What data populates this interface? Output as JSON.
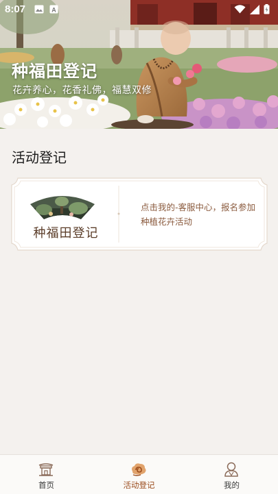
{
  "status_bar": {
    "time": "8:07",
    "left_icons": [
      "image-icon",
      "font-a-icon"
    ],
    "right_icons": [
      "wifi-icon",
      "signal-icon",
      "battery-icon"
    ]
  },
  "banner": {
    "title": "种福田登记",
    "subtitle": "花卉养心，花香礼佛，福慧双修"
  },
  "section": {
    "title": "活动登记"
  },
  "activity_card": {
    "title": "种福田登记",
    "description": "点击我的-客服中心，报名参加种植花卉活动"
  },
  "bottom_nav": {
    "items": [
      {
        "label": "首页",
        "icon": "temple-home-icon",
        "active": false
      },
      {
        "label": "活动登记",
        "icon": "cloud-swirl-icon",
        "active": true
      },
      {
        "label": "我的",
        "icon": "monk-profile-icon",
        "active": false
      }
    ]
  },
  "colors": {
    "accent": "#9a4b1c",
    "card_text": "#5b3d29",
    "card_desc": "#8a5a3d",
    "page_bg": "#f4f1ee"
  }
}
